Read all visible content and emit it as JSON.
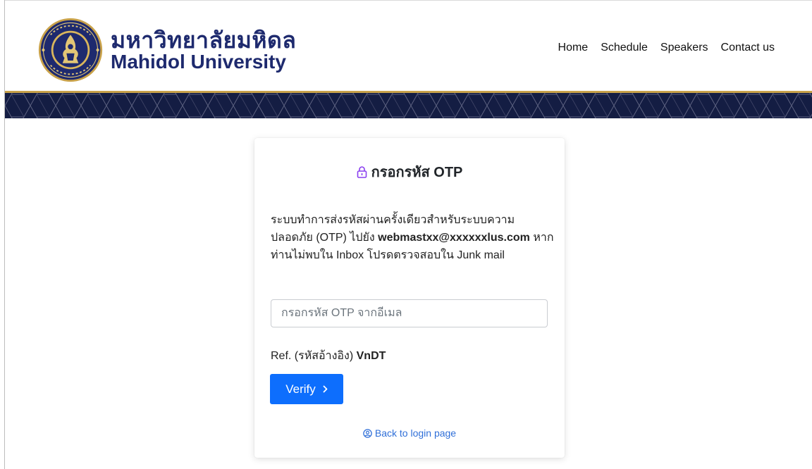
{
  "brand": {
    "name_th": "มหาวิทยาลัยมหิดล",
    "name_en": "Mahidol University",
    "seal_icon": "university-seal-icon"
  },
  "nav": {
    "items": [
      {
        "label": "Home"
      },
      {
        "label": "Schedule"
      },
      {
        "label": "Speakers"
      },
      {
        "label": "Contact us"
      }
    ]
  },
  "otp": {
    "title": "กรอกรหัส OTP",
    "desc_prefix": "ระบบทำการส่งรหัสผ่านครั้งเดียวสำหรับระบบความปลอดภัย (OTP) ไปยัง ",
    "email": "webmastxx@xxxxxxlus.com",
    "desc_suffix": " หากท่านไม่พบใน Inbox โปรดตรวจสอบใน Junk mail",
    "input_placeholder": "กรอกรหัส OTP จากอีเมล",
    "ref_label": "Ref. (รหัสอ้างอิง) ",
    "ref_code": "VnDT",
    "verify_label": "Verify",
    "verify_icon": "chevron-right-icon",
    "back_label": "Back to login page",
    "back_icon": "user-circle-icon"
  },
  "colors": {
    "brand_navy": "#1e2a6e",
    "band_navy": "#141d43",
    "gold": "#c8a24a",
    "primary": "#0d6efd",
    "lock_purple": "#8a3ff0",
    "link_blue": "#2f6fd8"
  }
}
